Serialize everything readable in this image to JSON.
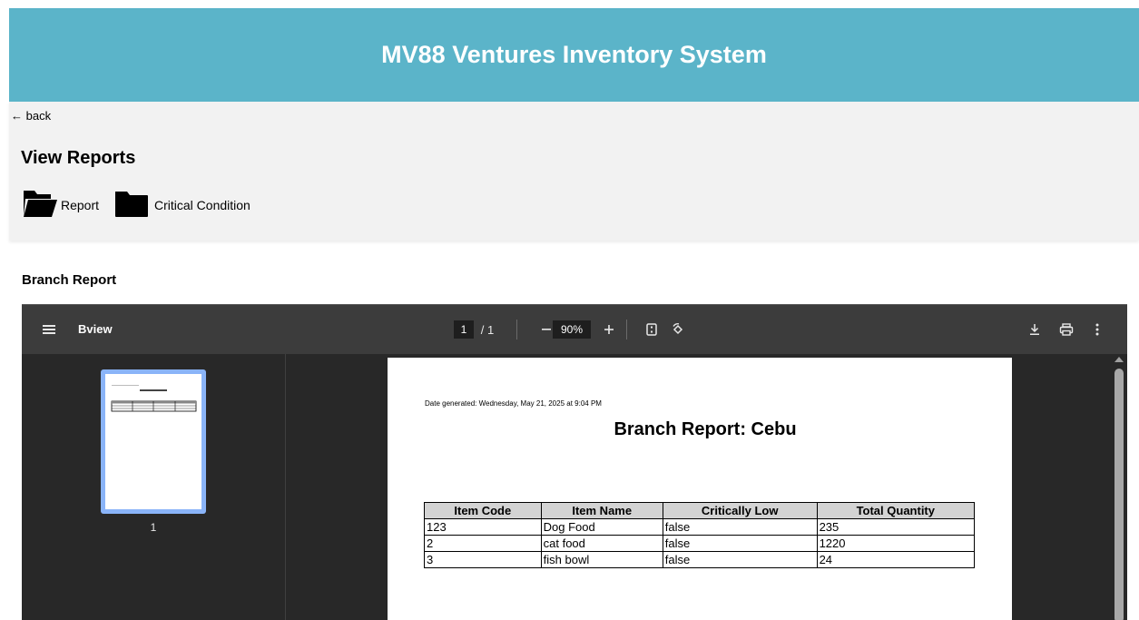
{
  "header": {
    "title": "MV88 Ventures Inventory System"
  },
  "nav": {
    "back_label": "← back"
  },
  "reports": {
    "title": "View Reports",
    "folders": [
      {
        "label": "Report",
        "icon": "folder-open-icon"
      },
      {
        "label": "Critical Condition",
        "icon": "folder-icon"
      }
    ]
  },
  "branch_report": {
    "title": "Branch Report"
  },
  "pdf_viewer": {
    "doc_title": "Bview",
    "page_current": "1",
    "page_total": "/ 1",
    "zoom": "90%",
    "thumbnail_page_number": "1",
    "icons": [
      "menu-icon",
      "zoom-out-icon",
      "zoom-in-icon",
      "fit-page-icon",
      "rotate-icon",
      "download-icon",
      "print-icon",
      "more-options-icon"
    ]
  },
  "document": {
    "date_generated": "Date generated: Wednesday, May 21, 2025 at 9:04 PM",
    "title": "Branch Report: Cebu",
    "columns": [
      "Item Code",
      "Item Name",
      "Critically Low",
      "Total Quantity"
    ],
    "rows": [
      [
        "123",
        "Dog Food",
        "false",
        "235"
      ],
      [
        "2",
        "cat food",
        "false",
        "1220"
      ],
      [
        "3",
        "fish bowl",
        "false",
        "24"
      ]
    ]
  },
  "colors": {
    "header_bg": "#5bb4c9",
    "panel_bg": "#f2f2f2",
    "viewer_bg": "#282828",
    "toolbar_bg": "#3c3c3c",
    "thumb_highlight": "#8ab4f8"
  }
}
